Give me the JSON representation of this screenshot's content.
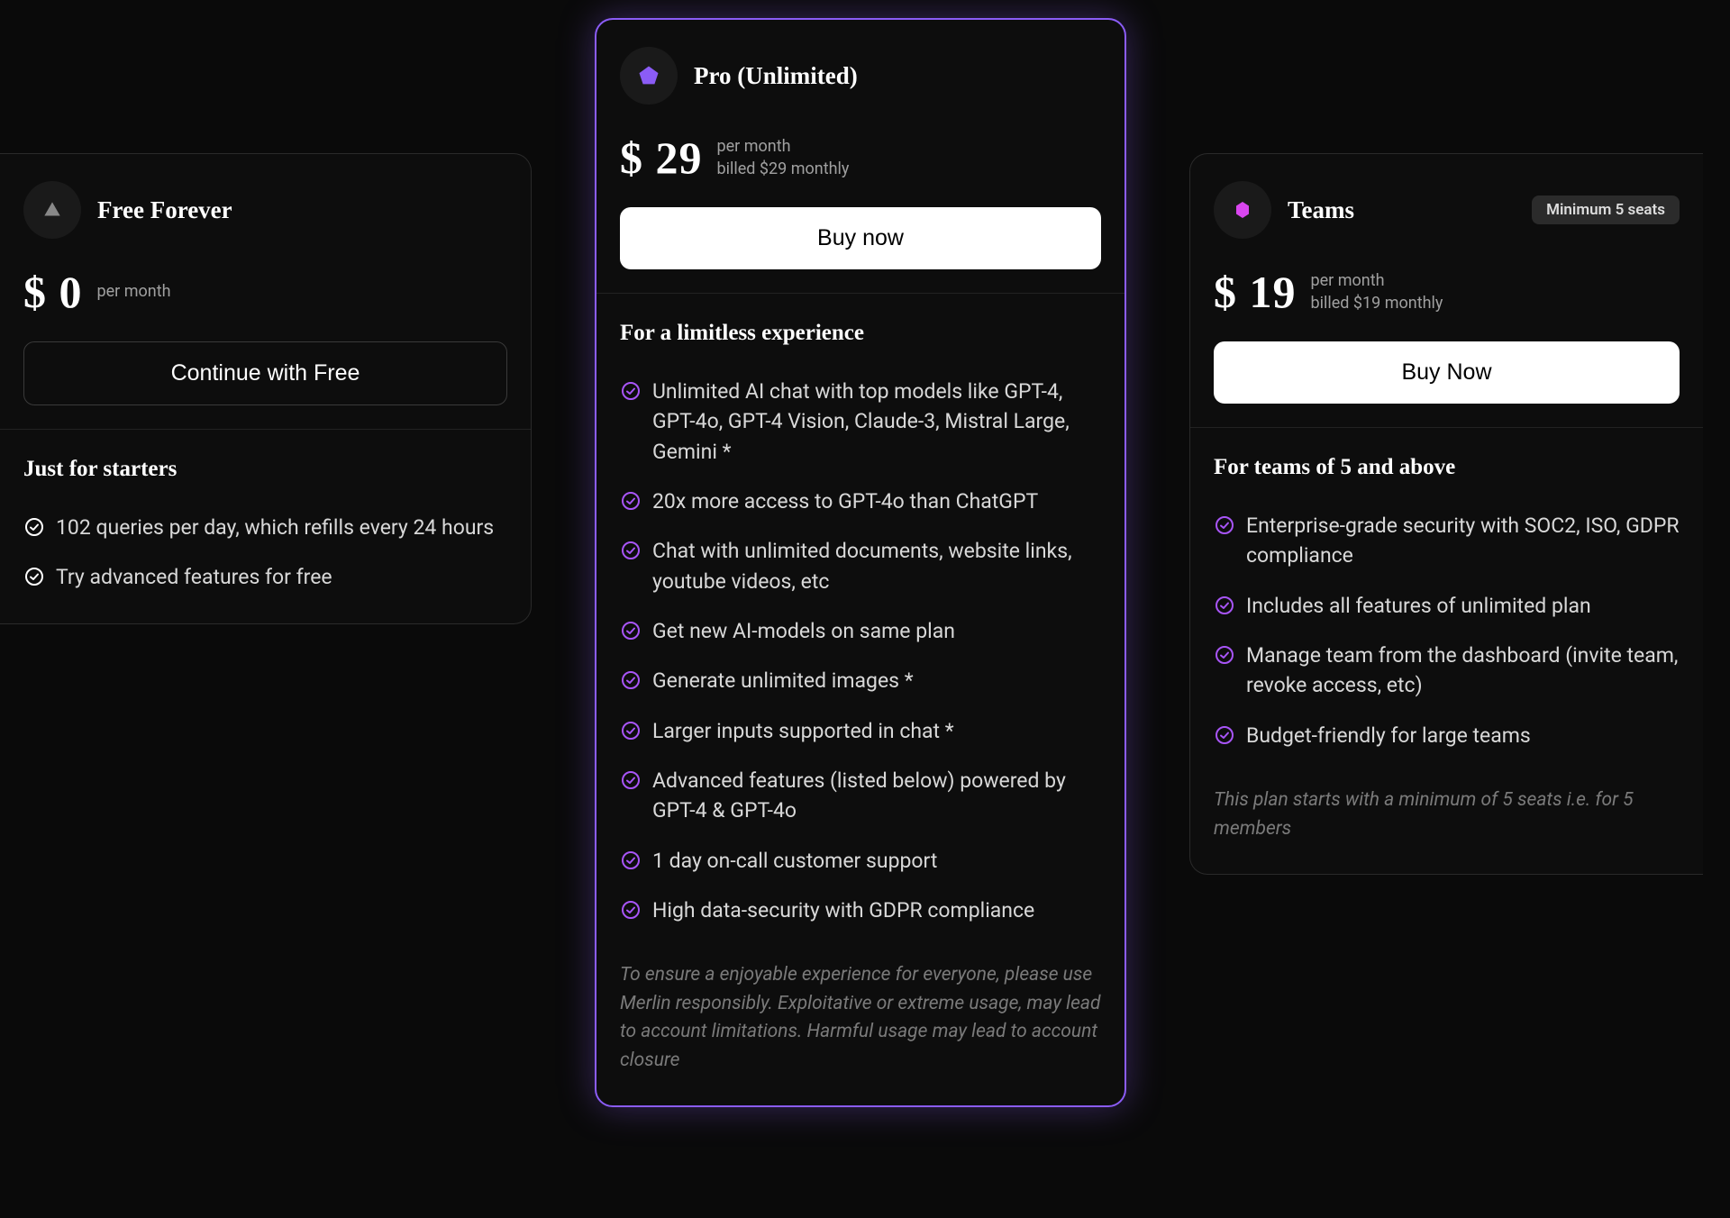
{
  "plans": {
    "free": {
      "title": "Free Forever",
      "price": "$ 0",
      "per": "per month",
      "cta": "Continue with Free",
      "features_title": "Just for starters",
      "features": [
        "102 queries per day, which refills every 24 hours",
        "Try advanced features for free"
      ]
    },
    "pro": {
      "title": "Pro (Unlimited)",
      "price": "$ 29",
      "per": "per month",
      "billed": "billed $29 monthly",
      "cta": "Buy now",
      "features_title": "For a limitless experience",
      "features": [
        "Unlimited AI chat with top models like GPT-4, GPT-4o, GPT-4 Vision, Claude-3, Mistral Large, Gemini *",
        "20x more access to GPT-4o than ChatGPT",
        "Chat with unlimited documents, website links, youtube videos, etc",
        "Get new AI-models on same plan",
        "Generate unlimited images *",
        "Larger inputs supported in chat *",
        "Advanced features (listed below) powered by GPT-4 & GPT-4o",
        "1 day on-call customer support",
        "High data-security with GDPR compliance"
      ],
      "note": "To ensure a enjoyable experience for everyone, please use Merlin responsibly. Exploitative or extreme usage, may lead to account limitations. Harmful usage may lead to account closure"
    },
    "teams": {
      "title": "Teams",
      "badge": "Minimum 5 seats",
      "price": "$ 19",
      "per": "per month",
      "billed": "billed $19 monthly",
      "cta": "Buy Now",
      "features_title": "For teams of 5 and above",
      "features": [
        "Enterprise-grade security with SOC2, ISO, GDPR compliance",
        "Includes all features of unlimited plan",
        "Manage team from the dashboard (invite team, revoke access, etc)",
        "Budget-friendly for large teams"
      ],
      "note": "This plan starts with a minimum of 5 seats i.e. for 5 members"
    }
  },
  "colors": {
    "accent": "#8b5cf6",
    "check_free": "#ffffff",
    "check_pro": "#a855f7",
    "check_teams": "#a855f7"
  }
}
